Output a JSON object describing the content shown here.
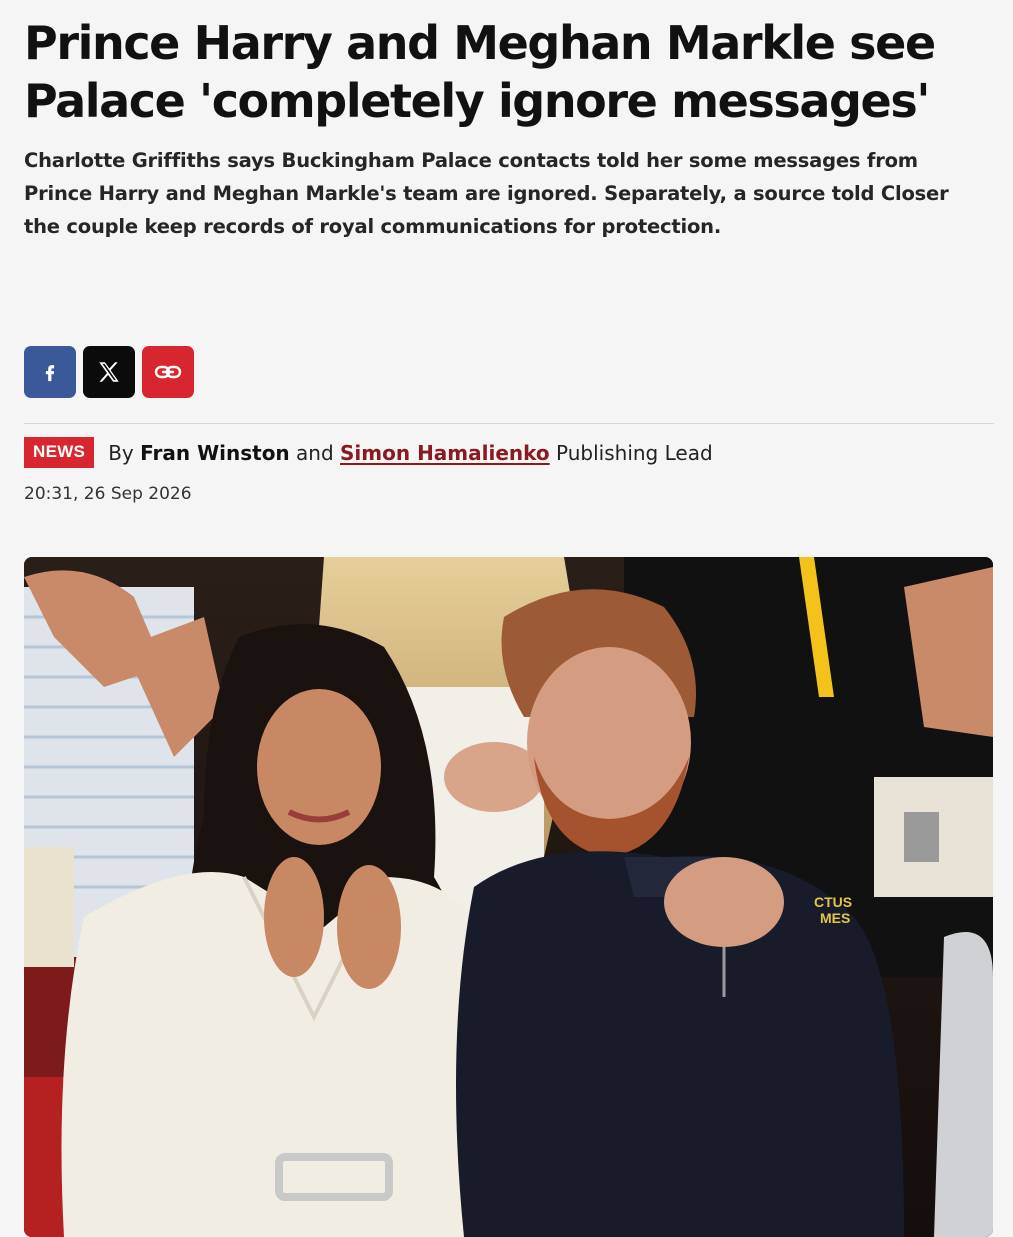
{
  "article": {
    "headline": "Prince Harry and Meghan Markle see Palace 'completely ignore messages'",
    "standfirst": "Charlotte Griffiths says Buckingham Palace contacts told her some messages from Prince Harry and Meghan Markle's team are ignored. Separately, a source told Closer the couple keep records of royal communications for protection.",
    "share": {
      "facebook_icon": "facebook-icon",
      "x_icon": "x-logo-icon",
      "link_icon": "link-icon"
    },
    "section_badge": "NEWS",
    "byline": {
      "prefix": "By",
      "author_1": "Fran Winston",
      "conjunction": "and",
      "author_2": "Simon Hamalienko",
      "author_2_role": "Publishing Lead"
    },
    "timestamp": "20:31, 26 Sep 2026"
  },
  "colors": {
    "accent_red": "#d7262f",
    "facebook_blue": "#3b5998",
    "x_black": "#0b0b0b",
    "author_link": "#8a1a20"
  }
}
